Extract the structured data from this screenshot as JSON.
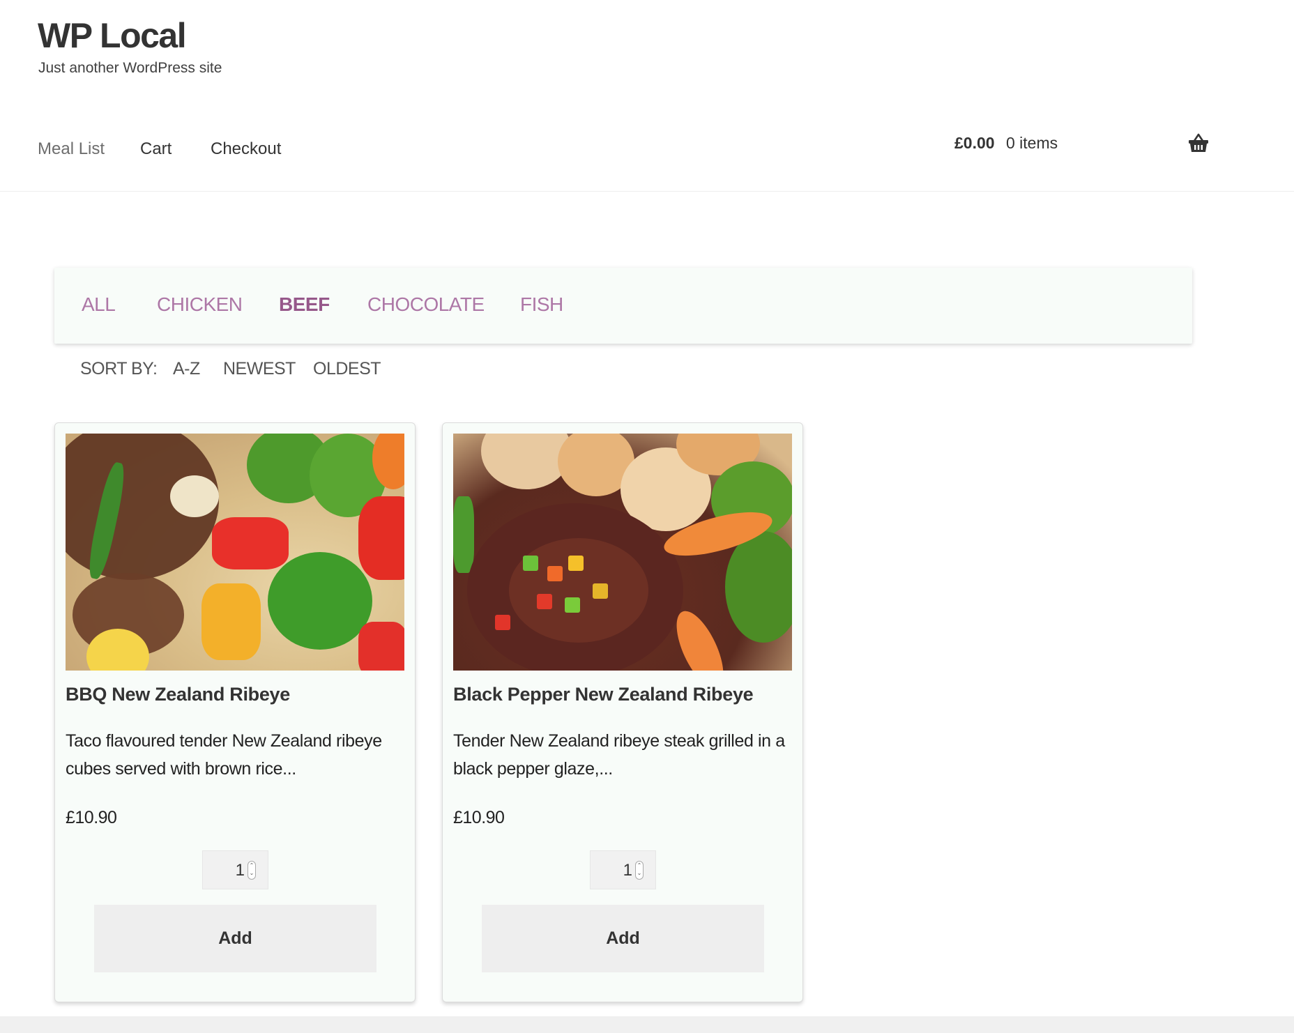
{
  "site": {
    "title": "WP Local",
    "tagline": "Just another WordPress site"
  },
  "nav": {
    "items": [
      {
        "label": "Meal List",
        "current": true
      },
      {
        "label": "Cart",
        "current": false
      },
      {
        "label": "Checkout",
        "current": false
      }
    ]
  },
  "cart": {
    "amount": "£0.00",
    "count": "0 items",
    "icon": "basket-icon"
  },
  "filters": {
    "items": [
      {
        "label": "ALL",
        "active": false
      },
      {
        "label": "CHICKEN",
        "active": false
      },
      {
        "label": "BEEF",
        "active": true
      },
      {
        "label": "CHOCOLATE",
        "active": false
      },
      {
        "label": "FISH",
        "active": false
      }
    ],
    "accent_color": "#96588a"
  },
  "sort": {
    "label": "SORT BY:",
    "options": [
      "A-Z",
      "NEWEST",
      "OLDEST"
    ]
  },
  "products": [
    {
      "name": "BBQ New Zealand Ribeye",
      "description": "Taco flavoured tender New Zealand ribeye cubes served with brown rice...",
      "price": "£10.90",
      "quantity": "1",
      "add_label": "Add",
      "image": "beef-with-rice-and-vegetables"
    },
    {
      "name": "Black Pepper New Zealand Ribeye",
      "description": "Tender New Zealand ribeye steak grilled in a black pepper glaze,...",
      "price": "£10.90",
      "quantity": "1",
      "add_label": "Add",
      "image": "steak-with-potatoes-and-vegetables"
    }
  ]
}
